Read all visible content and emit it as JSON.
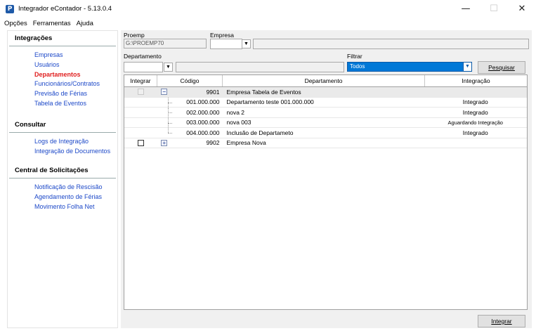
{
  "window": {
    "title": "Integrador eContador - 5.13.0.4",
    "icon_letter": "P",
    "minimize": "—",
    "maximize": "☐",
    "close": "✕"
  },
  "menu": [
    "Opções",
    "Ferramentas",
    "Ajuda"
  ],
  "sidebar": {
    "sections": [
      {
        "header": "Integrações",
        "items": [
          "Empresas",
          "Usuários",
          "Departamentos",
          "Funcionários/Contratos",
          "Previsão de Férias",
          "Tabela de Eventos"
        ]
      },
      {
        "header": "Consultar",
        "items": [
          "Logs de Integração",
          "Integração de Documentos"
        ]
      },
      {
        "header": "Central de Solicitações",
        "items": [
          "Notificação de Rescisão",
          "Agendamento de Férias",
          "Movimento Folha Net"
        ]
      }
    ],
    "active_item": "Departamentos"
  },
  "form": {
    "proemp_label": "Proemp",
    "proemp_value": "G:\\PROEMP70",
    "empresa_label": "Empresa",
    "empresa_value": "",
    "departamento_label": "Departamento",
    "departamento_value": "",
    "filtrar_label": "Filtrar",
    "filtrar_value": "Todos",
    "pesquisar_button": "Pesquisar"
  },
  "grid": {
    "columns": [
      "Integrar",
      "Código",
      "Departamento",
      "Integração"
    ],
    "rows": [
      {
        "type": "group",
        "expander": "−",
        "code": "9901",
        "name": "Empresa Tabela de Eventos",
        "status": ""
      },
      {
        "type": "child",
        "code": "001.000.000",
        "name": "Departamento teste 001.000.000",
        "status": "Integrado"
      },
      {
        "type": "child",
        "code": "002.000.000",
        "name": "nova 2",
        "status": "Integrado"
      },
      {
        "type": "child",
        "code": "003.000.000",
        "name": "nova 003",
        "status": "Aguardando Integração"
      },
      {
        "type": "child",
        "code": "004.000.000",
        "name": "Inclusão de Departameto",
        "status": "Integrado"
      },
      {
        "type": "group2",
        "expander": "+",
        "code": "9902",
        "name": "Empresa Nova",
        "status": ""
      }
    ]
  },
  "integrar_button": "Integrar"
}
